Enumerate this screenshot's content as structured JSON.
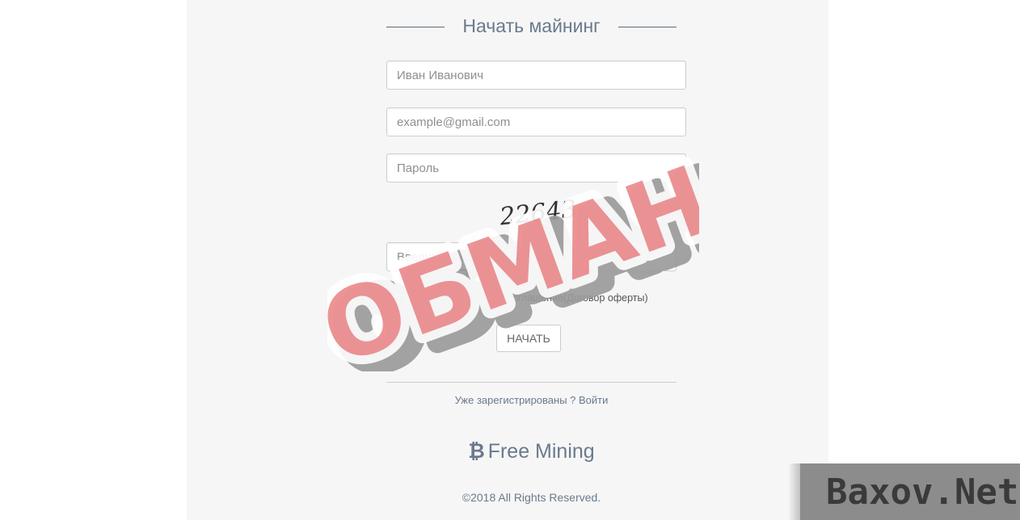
{
  "form": {
    "title": "Начать майнинг",
    "name_placeholder": "Иван Иванович",
    "email_placeholder": "example@gmail.com",
    "password_placeholder": "Пароль",
    "captcha_text": "22643",
    "code_placeholder": "Введите код",
    "code_tooltip": "Введите код",
    "agreement_label": "Пользовательское соглашение(Договор оферты)",
    "start_button": "НАЧАТЬ",
    "login_prompt": "Уже зарегистрированы ? Войти"
  },
  "footer": {
    "brand": "Free Mining",
    "brand_icon": "bitcoin-icon",
    "copyright": "©2018 All Rights Reserved."
  },
  "overlay": {
    "stamp_text": "ОБМАН",
    "watermark": "Baxov.Net"
  },
  "colors": {
    "accent": "#6a7a8c",
    "panel": "#f6f6f6",
    "stamp": "#e8797c"
  }
}
